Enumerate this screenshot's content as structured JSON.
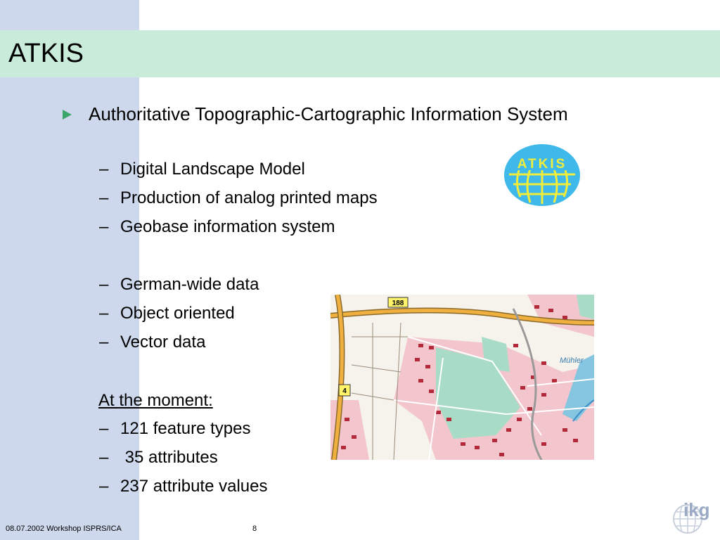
{
  "slide": {
    "title": "ATKIS",
    "main_bullet": "Authoritative Topographic-Cartographic Information System",
    "group1": [
      "Digital Landscape Model",
      "Production of analog printed maps",
      "Geobase information system"
    ],
    "group2": [
      "German-wide data",
      "Object oriented",
      "Vector data"
    ],
    "moment_label": "At the moment:",
    "group3": [
      "121 feature types",
      " 35 attributes",
      "237 attribute values"
    ],
    "dash": "–"
  },
  "logo": {
    "text": "ATKIS"
  },
  "map": {
    "road_188": "188",
    "road_4": "4",
    "place_label": "Mühler"
  },
  "footer": {
    "left": "08.07.2002 Workshop ISPRS/ICA",
    "page": "8",
    "ikg_logo_text": "ikg"
  }
}
